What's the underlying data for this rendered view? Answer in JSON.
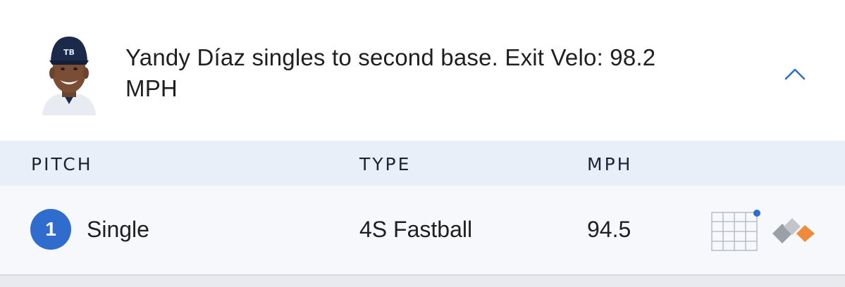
{
  "play": {
    "description_line1": "Yandy Díaz singles to second base. Exit Velo: 98.2",
    "description_line2": "MPH",
    "avatar_icon": "player-headshot",
    "toggle_icon": "chevron-up-icon"
  },
  "table": {
    "headers": {
      "pitch": "PITCH",
      "type": "TYPE",
      "mph": "MPH"
    },
    "rows": [
      {
        "number": "1",
        "result": "Single",
        "type": "4S Fastball",
        "mph": "94.5",
        "zone_icon": "strike-zone-icon",
        "trajectory_icon": "pitch-trajectory-icon"
      }
    ]
  },
  "colors": {
    "accent_blue": "#2f6ccd",
    "header_bg": "#e9eff8",
    "row_bg": "#f6f8fc",
    "trajectory_orange": "#f08a3c"
  }
}
